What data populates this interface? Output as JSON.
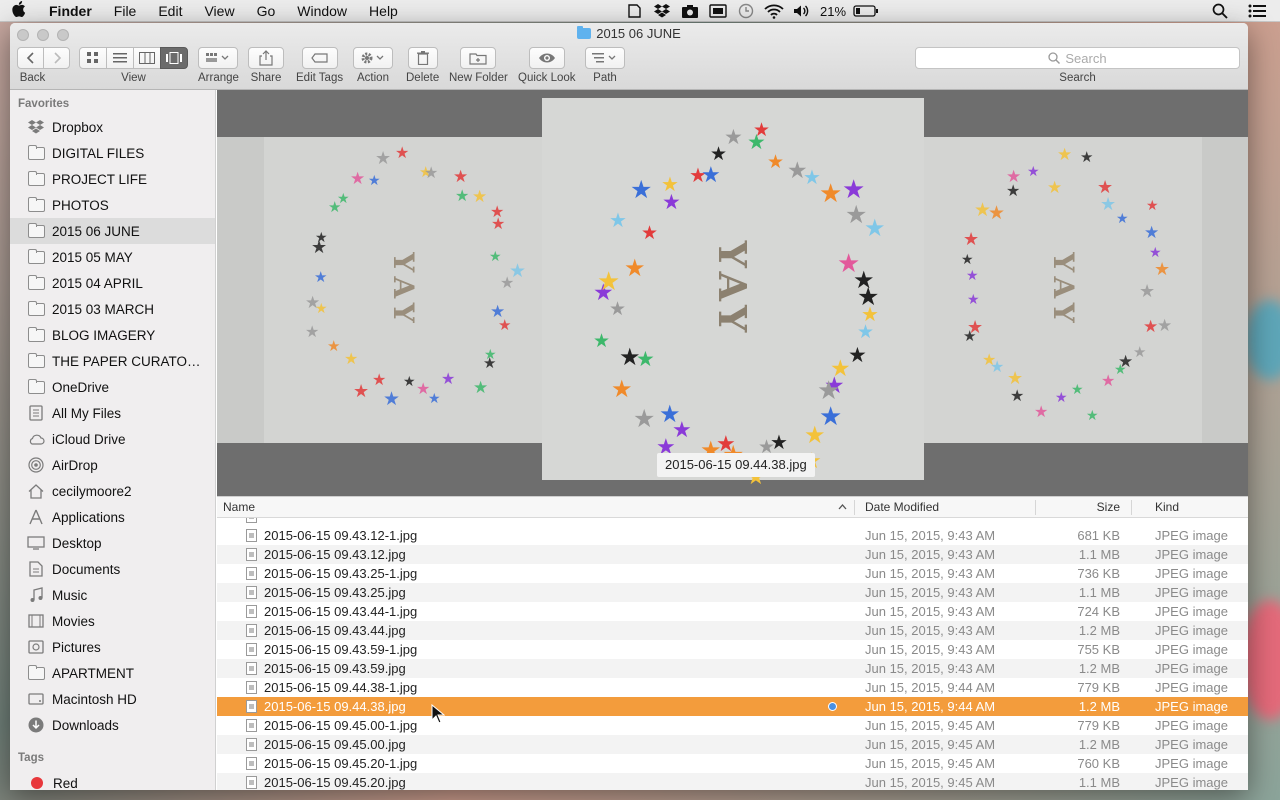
{
  "menubar": {
    "app_name": "Finder",
    "items": [
      "File",
      "Edit",
      "View",
      "Go",
      "Window",
      "Help"
    ],
    "battery_percent": "21%",
    "status_icons": [
      "dropbox-icon",
      "camera-icon",
      "display-icon",
      "time-machine-icon",
      "wifi-icon",
      "volume-icon",
      "battery-icon",
      "spotlight-icon",
      "notification-center-icon"
    ]
  },
  "window": {
    "title": "2015 06 JUNE"
  },
  "toolbar": {
    "back_label": "Back",
    "view_label": "View",
    "arrange_label": "Arrange",
    "share_label": "Share",
    "edit_tags_label": "Edit Tags",
    "action_label": "Action",
    "delete_label": "Delete",
    "new_folder_label": "New Folder",
    "quick_look_label": "Quick Look",
    "path_label": "Path",
    "search_placeholder": "Search",
    "search_label": "Search"
  },
  "sidebar": {
    "favorites_header": "Favorites",
    "items": [
      {
        "label": "Dropbox",
        "icon": "dropbox-icon"
      },
      {
        "label": "DIGITAL FILES",
        "icon": "folder-icon"
      },
      {
        "label": "PROJECT LIFE",
        "icon": "folder-icon"
      },
      {
        "label": "PHOTOS",
        "icon": "folder-icon"
      },
      {
        "label": "2015 06 JUNE",
        "icon": "folder-icon",
        "selected": true
      },
      {
        "label": "2015 05 MAY",
        "icon": "folder-icon"
      },
      {
        "label": "2015 04 APRIL",
        "icon": "folder-icon"
      },
      {
        "label": "2015 03 MARCH",
        "icon": "folder-icon"
      },
      {
        "label": "BLOG IMAGERY",
        "icon": "folder-icon"
      },
      {
        "label": "THE PAPER CURATO…",
        "icon": "folder-icon"
      },
      {
        "label": "OneDrive",
        "icon": "folder-icon"
      },
      {
        "label": "All My Files",
        "icon": "all-files-icon"
      },
      {
        "label": "iCloud Drive",
        "icon": "cloud-icon"
      },
      {
        "label": "AirDrop",
        "icon": "airdrop-icon"
      },
      {
        "label": "cecilymoore2",
        "icon": "home-icon"
      },
      {
        "label": "Applications",
        "icon": "applications-icon"
      },
      {
        "label": "Desktop",
        "icon": "desktop-icon"
      },
      {
        "label": "Documents",
        "icon": "documents-icon"
      },
      {
        "label": "Music",
        "icon": "music-icon"
      },
      {
        "label": "Movies",
        "icon": "movies-icon"
      },
      {
        "label": "Pictures",
        "icon": "pictures-icon"
      },
      {
        "label": "APARTMENT",
        "icon": "folder-icon"
      },
      {
        "label": "Macintosh HD",
        "icon": "disk-icon"
      },
      {
        "label": "Downloads",
        "icon": "downloads-icon"
      }
    ],
    "tags_header": "Tags",
    "tags": [
      {
        "label": "Red",
        "color": "#e8373b"
      }
    ]
  },
  "preview": {
    "caption": "2015-06-15 09.44.38.jpg",
    "photo_text": "YAY"
  },
  "list": {
    "columns": {
      "name": "Name",
      "date": "Date Modified",
      "size": "Size",
      "kind": "Kind"
    },
    "rows": [
      {
        "name": "2015-06-15 09.43.12-1.jpg",
        "date": "Jun 15, 2015, 9:43 AM",
        "size": "681 KB",
        "kind": "JPEG image"
      },
      {
        "name": "2015-06-15 09.43.12.jpg",
        "date": "Jun 15, 2015, 9:43 AM",
        "size": "1.1 MB",
        "kind": "JPEG image"
      },
      {
        "name": "2015-06-15 09.43.25-1.jpg",
        "date": "Jun 15, 2015, 9:43 AM",
        "size": "736 KB",
        "kind": "JPEG image"
      },
      {
        "name": "2015-06-15 09.43.25.jpg",
        "date": "Jun 15, 2015, 9:43 AM",
        "size": "1.1 MB",
        "kind": "JPEG image"
      },
      {
        "name": "2015-06-15 09.43.44-1.jpg",
        "date": "Jun 15, 2015, 9:43 AM",
        "size": "724 KB",
        "kind": "JPEG image"
      },
      {
        "name": "2015-06-15 09.43.44.jpg",
        "date": "Jun 15, 2015, 9:43 AM",
        "size": "1.2 MB",
        "kind": "JPEG image"
      },
      {
        "name": "2015-06-15 09.43.59-1.jpg",
        "date": "Jun 15, 2015, 9:43 AM",
        "size": "755 KB",
        "kind": "JPEG image"
      },
      {
        "name": "2015-06-15 09.43.59.jpg",
        "date": "Jun 15, 2015, 9:43 AM",
        "size": "1.2 MB",
        "kind": "JPEG image"
      },
      {
        "name": "2015-06-15 09.44.38-1.jpg",
        "date": "Jun 15, 2015, 9:44 AM",
        "size": "779 KB",
        "kind": "JPEG image"
      },
      {
        "name": "2015-06-15 09.44.38.jpg",
        "date": "Jun 15, 2015, 9:44 AM",
        "size": "1.2 MB",
        "kind": "JPEG image",
        "selected": true
      },
      {
        "name": "2015-06-15 09.45.00-1.jpg",
        "date": "Jun 15, 2015, 9:45 AM",
        "size": "779 KB",
        "kind": "JPEG image"
      },
      {
        "name": "2015-06-15 09.45.00.jpg",
        "date": "Jun 15, 2015, 9:45 AM",
        "size": "1.2 MB",
        "kind": "JPEG image"
      },
      {
        "name": "2015-06-15 09.45.20-1.jpg",
        "date": "Jun 15, 2015, 9:45 AM",
        "size": "760 KB",
        "kind": "JPEG image"
      },
      {
        "name": "2015-06-15 09.45.20.jpg",
        "date": "Jun 15, 2015, 9:45 AM",
        "size": "1.1 MB",
        "kind": "JPEG image"
      }
    ]
  },
  "colors": {
    "selection": "#f39c3c",
    "sidebar_selected": "#dcdcdc",
    "coverflow_bg": "#6e6e6e",
    "tag_red": "#e8373b"
  }
}
